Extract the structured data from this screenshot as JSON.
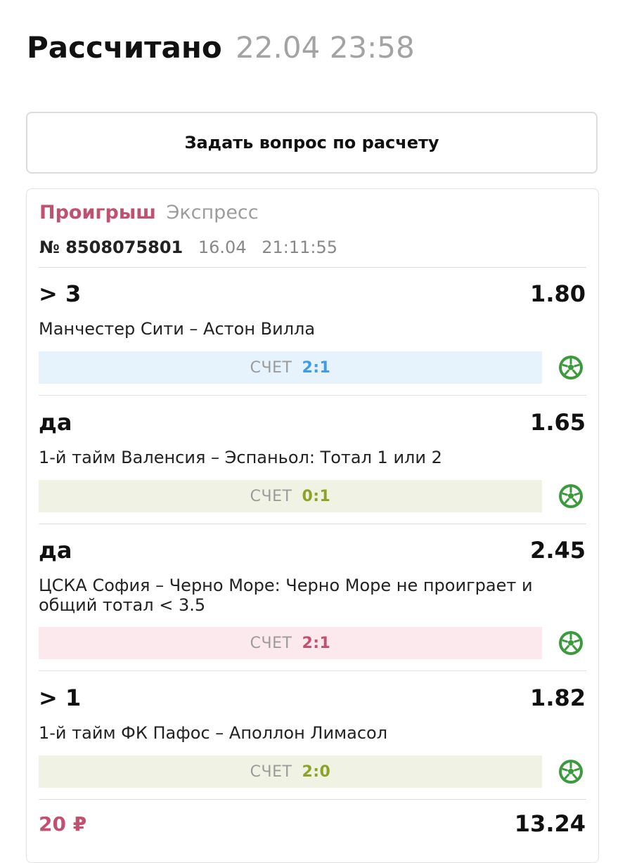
{
  "header": {
    "status": "Рассчитано",
    "datetime": "22.04 23:58"
  },
  "ask_button": "Задать вопрос по расчету",
  "bet": {
    "result": "Проигрыш",
    "type": "Экспресс",
    "number": "№ 8508075801",
    "date": "16.04",
    "time": "21:11:55",
    "score_label": "СЧЕТ",
    "icon": "soccer-ball-icon",
    "colors": {
      "loss": "#c0526f",
      "win": "#8da326",
      "live": "#3d9be9",
      "ball": "#3b9a3b"
    },
    "events": [
      {
        "outcome": "> 3",
        "coef": "1.80",
        "match": "Манчестер Сити – Астон Вилла",
        "score": "2:1",
        "state": "blue"
      },
      {
        "outcome": "да",
        "coef": "1.65",
        "match": "1-й тайм Валенсия – Эспаньол: Тотал 1 или 2",
        "score": "0:1",
        "state": "green"
      },
      {
        "outcome": "да",
        "coef": "2.45",
        "match": "ЦСКА София – Черно Море: Черно Море не проиграет и общий тотал < 3.5",
        "score": "2:1",
        "state": "red"
      },
      {
        "outcome": "> 1",
        "coef": "1.82",
        "match": "1-й тайм ФК Пафос – Аполлон Лимасол",
        "score": "2:0",
        "state": "green"
      }
    ],
    "stake": "20 ₽",
    "total_coef": "13.24"
  }
}
